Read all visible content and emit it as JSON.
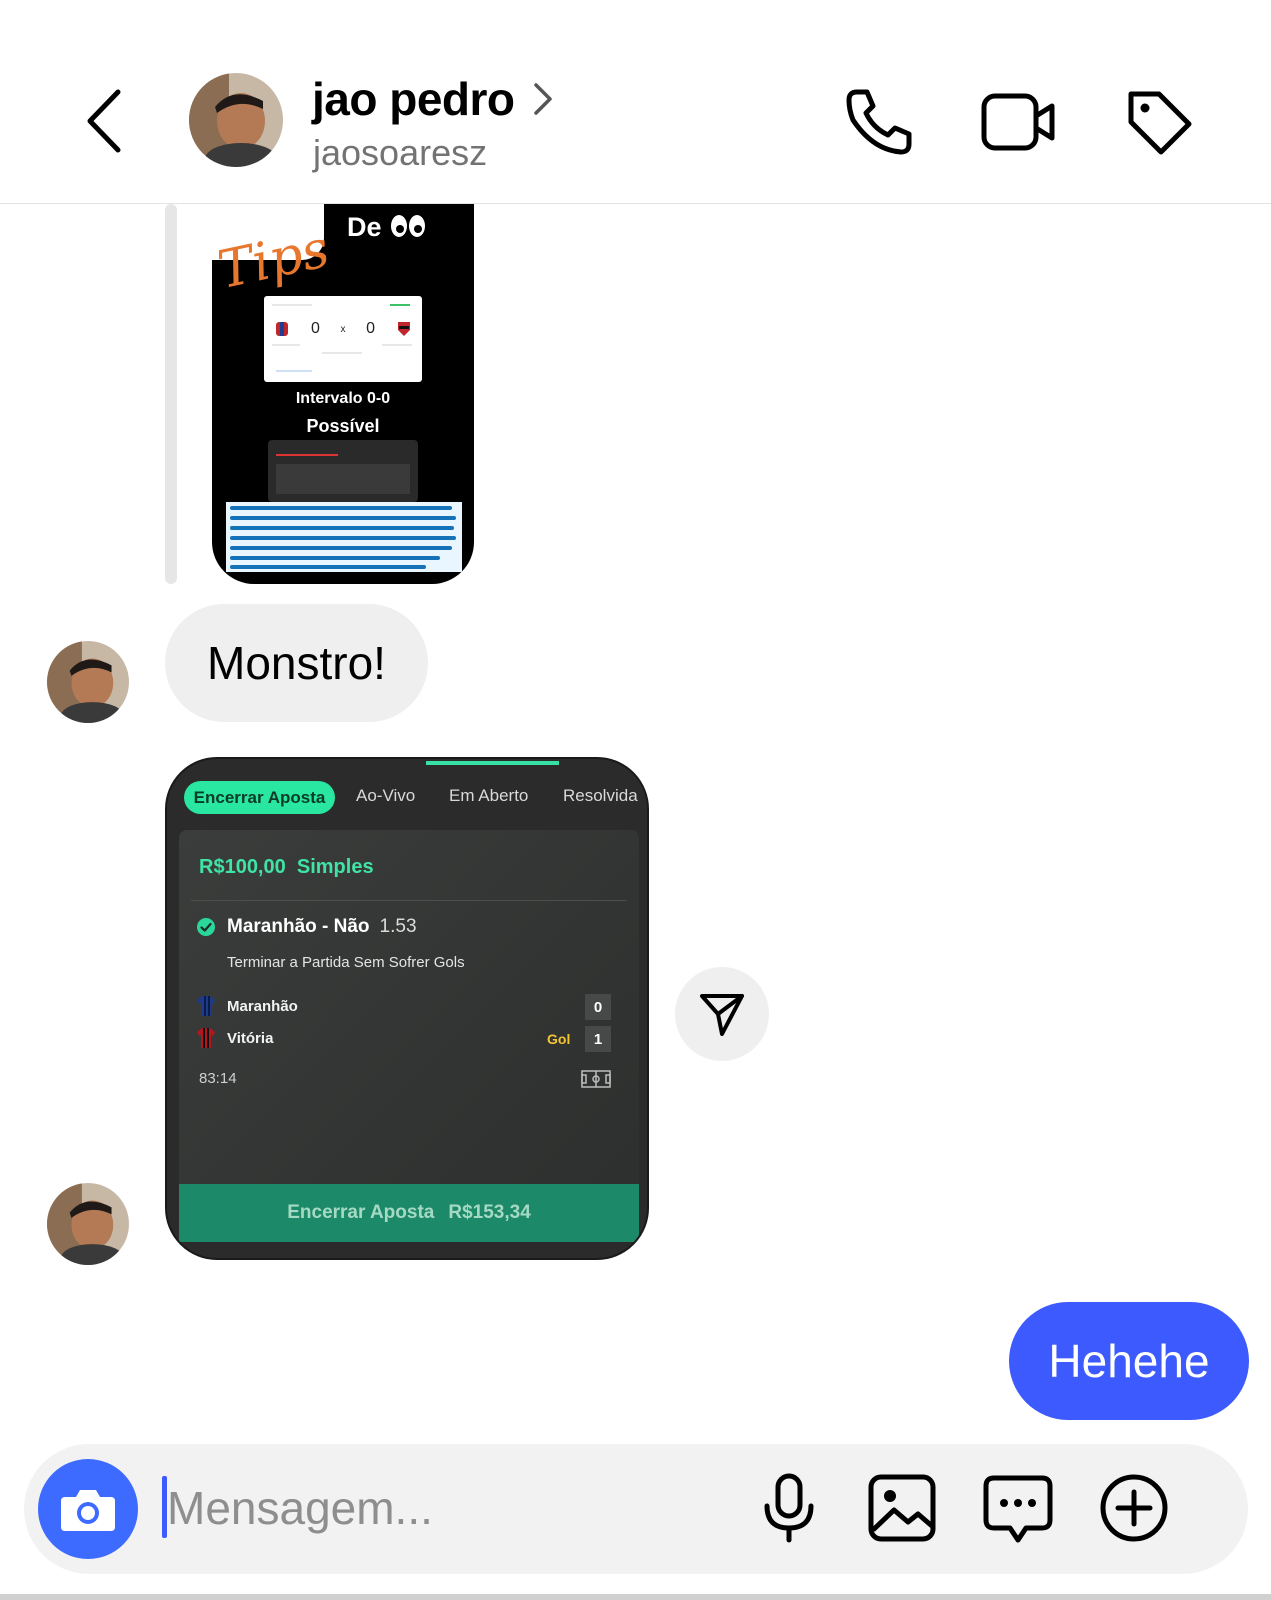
{
  "header": {
    "name": "jao pedro",
    "username": "jaosoaresz",
    "icons": [
      "back-chevron-icon",
      "phone-icon",
      "video-camera-icon",
      "tag-icon"
    ]
  },
  "story": {
    "title_script": "Tips",
    "heading": "De",
    "line1": "Intervalo 0-0",
    "line2": "Possível",
    "score_home": "0",
    "score_sep": "x",
    "score_away": "0"
  },
  "messages": {
    "incoming_text": "Monstro!",
    "outgoing_text": "Hehehe"
  },
  "bet": {
    "tabs": [
      "Encerrar Aposta",
      "Ao-Vivo",
      "Em Aberto",
      "Resolvida"
    ],
    "active_tab": "Em Aberto",
    "stake": "R$100,00",
    "bet_type": "Simples",
    "pick": "Maranhão - Não",
    "odd": "1.53",
    "market": "Terminar a Partida Sem Sofrer Gols",
    "team1": {
      "name": "Maranhão",
      "score": "0"
    },
    "team2": {
      "name": "Vitória",
      "score": "1",
      "event": "Gol"
    },
    "clock": "83:14",
    "cashout_label": "Encerrar Aposta",
    "cashout_value": "R$153,34",
    "colors": {
      "accent": "#29e6a0",
      "cashout": "#1c8a68",
      "goal": "#f2c531"
    }
  },
  "composer": {
    "placeholder": "Mensagem...",
    "icons": [
      "camera-icon",
      "microphone-icon",
      "gallery-icon",
      "sticker-chat-icon",
      "plus-circle-icon"
    ]
  },
  "colors": {
    "outgoing_bubble": "#3d5afe",
    "incoming_bubble": "#efefef",
    "camera_button": "#3d6bff"
  }
}
